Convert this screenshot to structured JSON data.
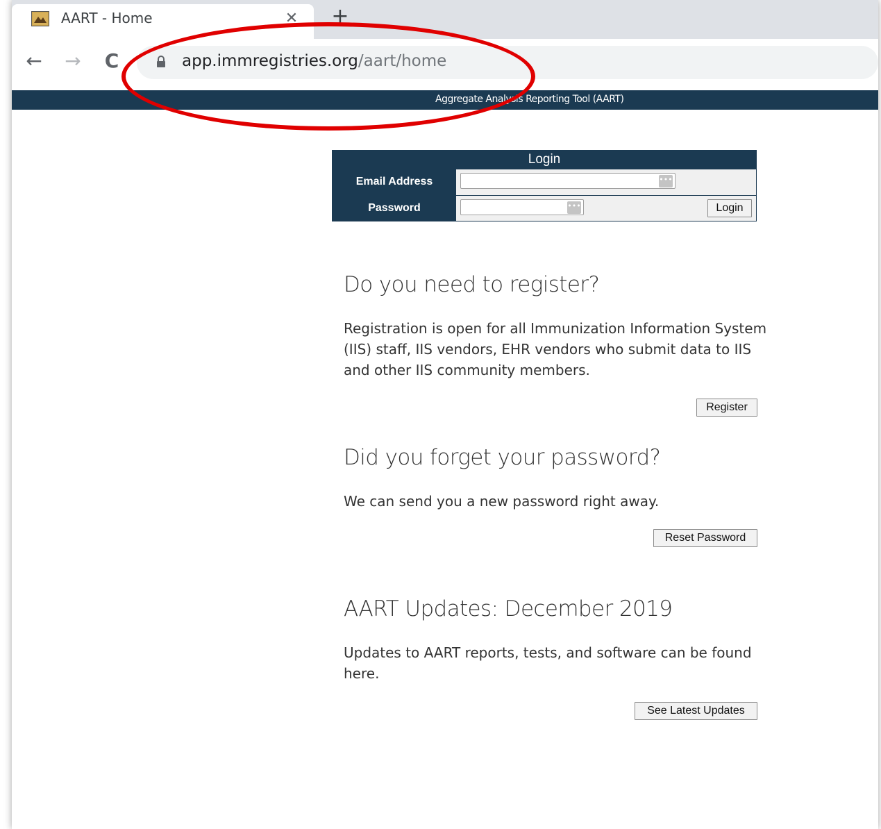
{
  "browser": {
    "tab_title": "AART - Home",
    "tab_close": "✕",
    "new_tab": "+",
    "back": "←",
    "forward": "→",
    "reload": "C",
    "url_host": "app.immregistries.org",
    "url_path": "/aart/home"
  },
  "site": {
    "banner": "Aggregate Analysis Reporting Tool (AART)"
  },
  "login": {
    "header": "Login",
    "email_label": "Email Address",
    "password_label": "Password",
    "email_value": "",
    "password_value": "",
    "button": "Login"
  },
  "sections": {
    "register": {
      "title": "Do you need to register?",
      "text": "Registration is open for all Immunization Information System (IIS) staff, IIS vendors, EHR vendors who submit data to IIS and other IIS community members.",
      "button": "Register"
    },
    "forgot": {
      "title": "Did you forget your password?",
      "text": "We can send you a new password right away.",
      "button": "Reset Password"
    },
    "updates": {
      "title": "AART Updates: December 2019",
      "text": "Updates to AART reports, tests, and software can be found here.",
      "button": "See Latest Updates"
    }
  },
  "colors": {
    "brand_navy": "#1b3a52",
    "annotation_red": "#e00000"
  }
}
